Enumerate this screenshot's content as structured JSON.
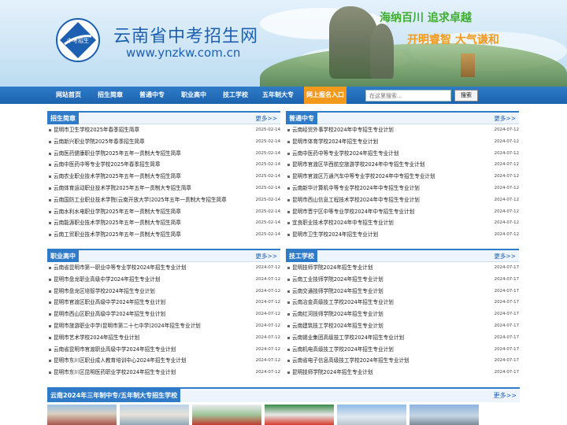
{
  "header": {
    "site_title": "云南省中考招生网",
    "site_url": "www.ynzkw.com.cn",
    "logo_text": "中考招生",
    "slogan_1": "海纳百川 追求卓越",
    "slogan_2": "开明睿智 大气谦和"
  },
  "nav": {
    "items": [
      {
        "label": "网站首页"
      },
      {
        "label": "招生简章"
      },
      {
        "label": "普通中专"
      },
      {
        "label": "职业高中"
      },
      {
        "label": "技工学校"
      },
      {
        "label": "五年制大专"
      },
      {
        "label": "网上报名入口"
      }
    ],
    "search_placeholder": "在这里搜索...",
    "search_button": "搜索"
  },
  "panels": [
    {
      "title": "招生简章",
      "more": "更多>>",
      "items": [
        {
          "text": "昆明市卫生学校2025年春季招生简章",
          "date": "2025-02-14"
        },
        {
          "text": "云南新兴职业学院2025年春季招生简章",
          "date": "2025-02-14"
        },
        {
          "text": "云南医药健康职业学院2025年五年一贯制大专招生简章",
          "date": "2025-02-14"
        },
        {
          "text": "云南中医药中等专业学校2025年春季招生简章",
          "date": "2025-02-14"
        },
        {
          "text": "云南农业职业技术学院2025年五年一贯制大专招生简章",
          "date": "2025-02-14"
        },
        {
          "text": "云南体育运动职业技术学院2025年五年一贯制大专招生简章",
          "date": "2025-02-14"
        },
        {
          "text": "云南国防工业职业技术学院(云南开放大学)2025年五年一贯制大专招生简章",
          "date": "2025-02-14"
        },
        {
          "text": "云南水利水电职业学院2025年五年一贯制大专招生简章",
          "date": "2025-02-14"
        },
        {
          "text": "云南能源职业技术学院2025年五年一贯制大专招生简章",
          "date": "2025-02-14"
        },
        {
          "text": "云南工贸职业技术学院2025年五年一贯制大专招生简章",
          "date": "2025-02-14"
        }
      ]
    },
    {
      "title": "普通中专",
      "more": "更多>>",
      "items": [
        {
          "text": "云南经贸外事学校2024年中专招生专业计划",
          "date": "2024-07-12"
        },
        {
          "text": "昆明市体育学校2024年招生专业计划",
          "date": "2024-07-12"
        },
        {
          "text": "云南中医药中等专业学校2024年招生专业计划",
          "date": "2024-07-12"
        },
        {
          "text": "昆明市官渡区华西航空旅游学校2024年中专招生专业计划",
          "date": "2024-07-12"
        },
        {
          "text": "昆明市官渡区万通汽车中等专业学校2024年中专招生专业计划",
          "date": "2024-07-12"
        },
        {
          "text": "云南新华计算机中等专业学校2024年中专招生专业计划",
          "date": "2024-07-12"
        },
        {
          "text": "昆明市西山信息工程技术学校2024年中专招生专业计划",
          "date": "2024-07-12"
        },
        {
          "text": "昆明市晋宁区中等专业学校2024年中专招生专业计划",
          "date": "2024-07-12"
        },
        {
          "text": "宜良职业技术学校2024年中专招生专业计划",
          "date": "2024-07-12"
        },
        {
          "text": "昆明市卫生学校2024年招生专业计划",
          "date": "2024-07-12"
        }
      ]
    },
    {
      "title": "职业高中",
      "more": "更多>>",
      "items": [
        {
          "text": "云南省昆明市第一职业中等专业学校2024年招生专业计划",
          "date": "2024-07-12"
        },
        {
          "text": "昆明市盘龙职业高级中学2024年招生专业计划",
          "date": "2024-07-12"
        },
        {
          "text": "昆明市盘龙区培智学校2024年招生专业计划",
          "date": "2024-07-12"
        },
        {
          "text": "昆明市官渡区职业高级中学2024年招生专业计划",
          "date": "2024-07-12"
        },
        {
          "text": "昆明市西山区职业高级中学2024年招生专业计划",
          "date": "2024-07-12"
        },
        {
          "text": "昆明市旅游职业中学(昆明市第二十七中学)2024年招生专业计划",
          "date": "2024-07-12"
        },
        {
          "text": "昆明市艺术学校2024年招生专业计划",
          "date": "2024-07-12"
        },
        {
          "text": "云南省昆明市官渡职业高级中学2024年招生专业计划",
          "date": "2024-07-12"
        },
        {
          "text": "昆明市东川区职业成人教育培训中心2024年招生专业计划",
          "date": "2024-07-12"
        },
        {
          "text": "昆明市东川区昆明医药职业学校2024年招生专业计划",
          "date": "2024-07-12"
        }
      ]
    },
    {
      "title": "技工学校",
      "more": "更多>>",
      "items": [
        {
          "text": "昆明技师学院2024年招生专业计划",
          "date": "2024-07-17"
        },
        {
          "text": "云南工业技师学院2024年招生专业计划",
          "date": "2024-07-17"
        },
        {
          "text": "云南交通技师学院2024年招生专业计划",
          "date": "2024-07-17"
        },
        {
          "text": "云南冶金高级技工学校2024年招生专业计划",
          "date": "2024-07-17"
        },
        {
          "text": "云南红河技师学院2024年招生专业计划",
          "date": "2024-07-17"
        },
        {
          "text": "云南建筑技工学校2024年招生专业计划",
          "date": "2024-07-17"
        },
        {
          "text": "云南锡业集团高级技工学校2024年招生专业计划",
          "date": "2024-07-17"
        },
        {
          "text": "云南机电高级技工学校2024年招生专业计划",
          "date": "2024-07-17"
        },
        {
          "text": "云南省电子信息高级技工学校2024年招生专业计划",
          "date": "2024-07-17"
        },
        {
          "text": "昆明技师学院2024年招生专业计划",
          "date": "2024-07-17"
        }
      ]
    }
  ],
  "bottom": {
    "title": "云南2024年三年制中专/五年制大专招生学校",
    "more": "更多>>"
  },
  "colors": {
    "brand_blue": "#2f7bc8",
    "nav_active": "#f39a1c",
    "slogan_green": "#3fae2e",
    "slogan_orange": "#f39a1c"
  }
}
